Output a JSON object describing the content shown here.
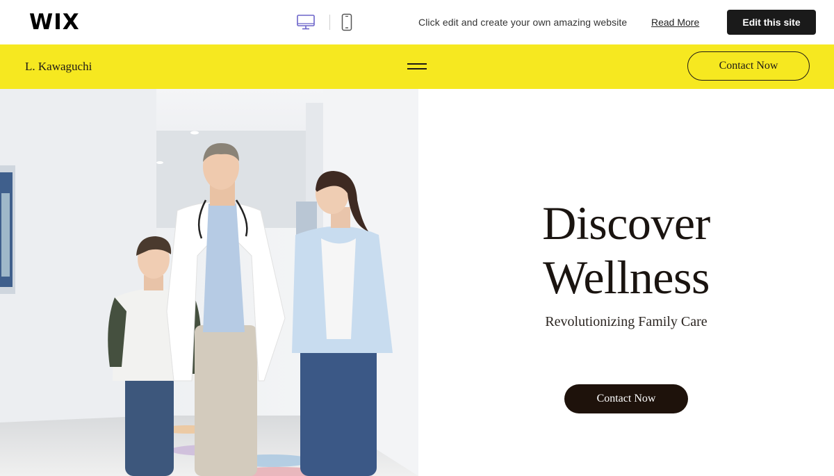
{
  "wix_bar": {
    "logo": "WIX",
    "device_icons": [
      "desktop-icon",
      "mobile-icon"
    ],
    "promo_text": "Click edit and create your own amazing website",
    "read_more": "Read More",
    "edit_button": "Edit this site"
  },
  "header": {
    "site_name": "L. Kawaguchi",
    "menu_icon": "hamburger-menu-icon",
    "contact_button": "Contact Now",
    "background": "#f6e820"
  },
  "hero": {
    "title_line1": "Discover",
    "title_line2": "Wellness",
    "subtitle": "Revolutionizing Family Care",
    "contact_button": "Contact Now",
    "button_color": "#1e120b"
  },
  "colors": {
    "accent_yellow": "#f6e820",
    "dark": "#1a1a1a",
    "device_active": "#6b63c9"
  }
}
